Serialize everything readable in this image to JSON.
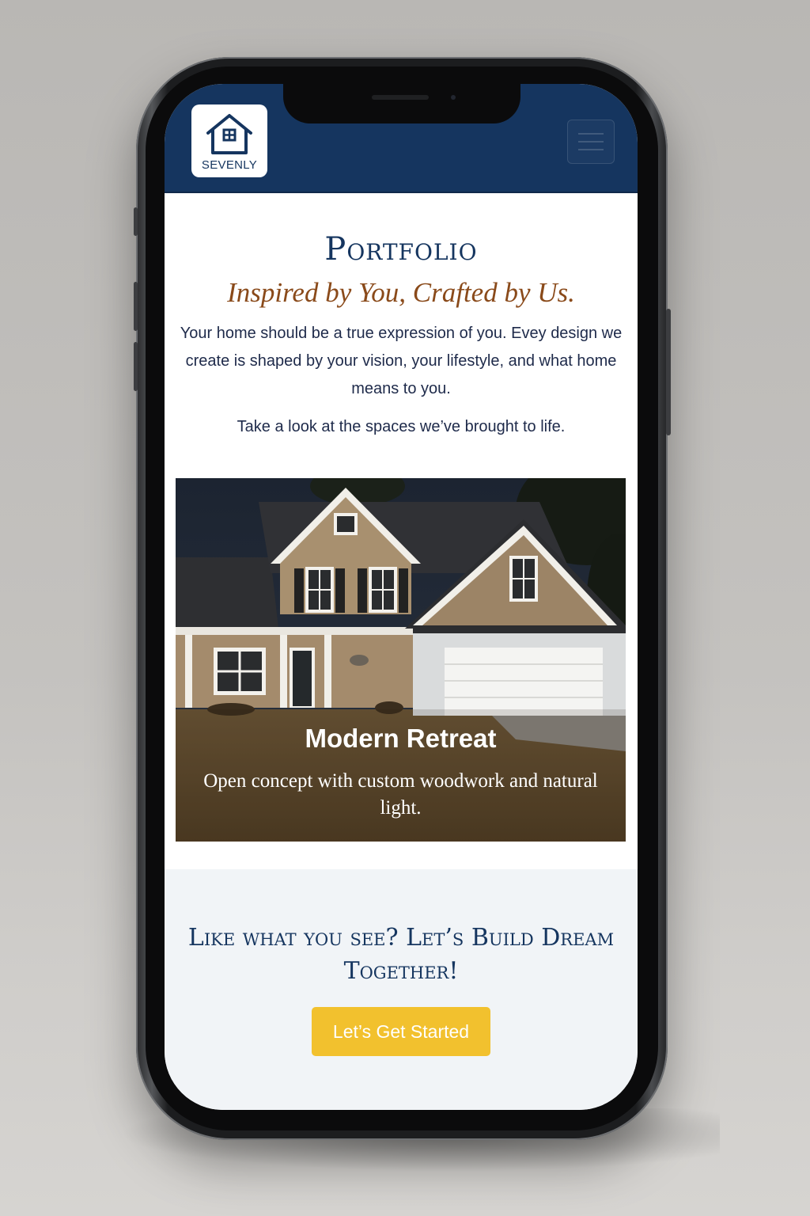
{
  "header": {
    "logo_text": "SEVENLY",
    "menu_icon": "hamburger-menu-icon",
    "background_color": "#15355f"
  },
  "portfolio": {
    "title": "Portfolio",
    "tagline": "Inspired by You, Crafted by Us.",
    "intro": "Your home should be a true expression of you. Evey design we create is shaped by your vision, your lifestyle, and what home means to you.",
    "intro_secondary": "Take a look at the spaces we’ve brought to life."
  },
  "project": {
    "title": "Modern Retreat",
    "description": "Open concept with custom woodwork and natural light."
  },
  "cta": {
    "heading": "Like what you see? Let’s Build Dream Together!",
    "button_label": "Let’s Get Started",
    "button_color": "#f2c12e"
  },
  "colors": {
    "primary_navy": "#15355f",
    "accent_brown": "#8a4a1a"
  }
}
